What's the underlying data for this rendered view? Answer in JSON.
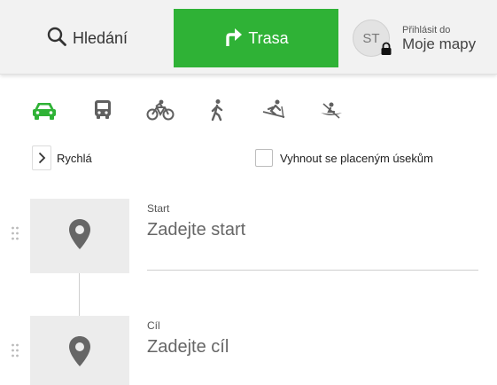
{
  "colors": {
    "accent": "#2fb236",
    "icon_gray": "#606060",
    "pin_gray": "#666666"
  },
  "tabs": {
    "search": {
      "label": "Hledání",
      "icon": "search-icon"
    },
    "route": {
      "label": "Trasa",
      "icon": "turn-right-arrow-icon",
      "active": true
    }
  },
  "login": {
    "avatar_initials": "ST",
    "small_text": "Přihlásit do",
    "big_text": "Moje mapy",
    "icon": "lock-icon"
  },
  "transport_modes": [
    {
      "name": "car",
      "icon": "car-icon",
      "selected": true
    },
    {
      "name": "public-transport",
      "icon": "bus-icon",
      "selected": false
    },
    {
      "name": "bike",
      "icon": "bicycle-icon",
      "selected": false
    },
    {
      "name": "walk",
      "icon": "hiking-icon",
      "selected": false
    },
    {
      "name": "ski",
      "icon": "ski-icon",
      "selected": false
    },
    {
      "name": "boat",
      "icon": "canoe-icon",
      "selected": false
    }
  ],
  "options": {
    "route_type": "Rychlá",
    "avoid_tolls_label": "Vyhnout se placeným úsekům",
    "avoid_tolls_checked": false
  },
  "waypoints": {
    "start": {
      "label": "Start",
      "placeholder": "Zadejte start",
      "value": ""
    },
    "end": {
      "label": "Cíl",
      "placeholder": "Zadejte cíl",
      "value": ""
    }
  }
}
